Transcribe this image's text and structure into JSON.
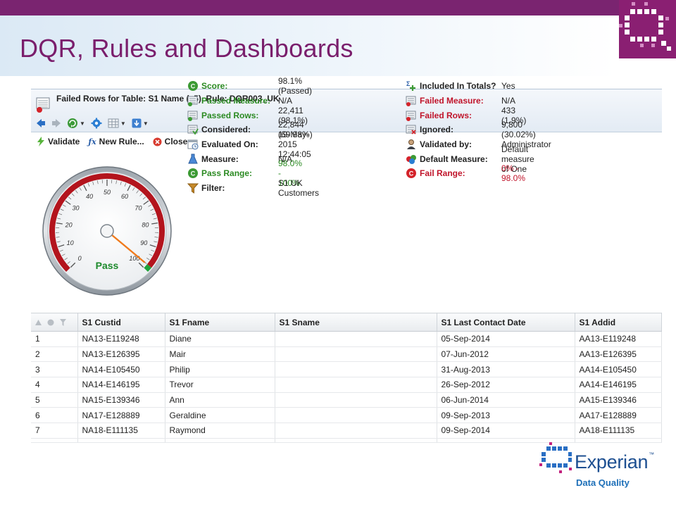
{
  "slide": {
    "title": "DQR, Rules and Dashboards"
  },
  "window": {
    "title": "Failed Rows for Table: S1 Name (v5),  Rule: DQR003_UK"
  },
  "actions": {
    "validate": "Validate",
    "new_rule": "New Rule...",
    "close": "Close"
  },
  "gauge": {
    "status": "Pass",
    "score": 98.1,
    "tick_labels": [
      "0",
      "10",
      "20",
      "30",
      "40",
      "50",
      "60",
      "70",
      "80",
      "90",
      "100"
    ]
  },
  "stats_left": [
    {
      "label": "Score:",
      "value": "98.1%  (Passed)",
      "icon": "score-icon",
      "tone": "green-label"
    },
    {
      "label": "Passed Measure:",
      "value": "N/A",
      "icon": "passed-measure-icon",
      "tone": "green-label"
    },
    {
      "label": "Passed Rows:",
      "value": "22,411 (98.1%)",
      "icon": "passed-rows-icon",
      "tone": "green-label"
    },
    {
      "label": "Considered:",
      "value": "22,844 (69.98%)",
      "icon": "considered-icon",
      "tone": "normal"
    },
    {
      "label": "Evaluated On:",
      "value": "19-May-2015 12:44:05",
      "icon": "calendar-icon",
      "tone": "normal"
    },
    {
      "label": "Measure:",
      "value": "N/A",
      "icon": "flask-icon",
      "tone": "normal"
    },
    {
      "label": "Pass Range:",
      "value": "98.0% - 100%",
      "icon": "pass-range-icon",
      "tone": "green-both"
    },
    {
      "label": "Filter:",
      "value": "S1 UK Customers",
      "icon": "filter-icon",
      "tone": "normal"
    }
  ],
  "stats_right": [
    {
      "label": "Included In Totals?",
      "value": "Yes",
      "icon": "sigma-plus-icon",
      "tone": "normal"
    },
    {
      "label": "Failed Measure:",
      "value": "N/A",
      "icon": "failed-measure-icon",
      "tone": "red-label"
    },
    {
      "label": "Failed Rows:",
      "value": "433 (1.9%)",
      "icon": "failed-rows-icon",
      "tone": "red-label"
    },
    {
      "label": "Ignored:",
      "value": "9,800 (30.02%)",
      "icon": "ignored-icon",
      "tone": "normal"
    },
    {
      "label": "Validated by:",
      "value": "Administrator",
      "icon": "user-icon",
      "tone": "normal"
    },
    {
      "label": "Default Measure:",
      "value": "Default measure of One",
      "icon": "default-measure-icon",
      "tone": "normal"
    },
    {
      "label": "Fail Range:",
      "value": "0% - 98.0%",
      "icon": "fail-range-icon",
      "tone": "red-both"
    }
  ],
  "table": {
    "columns": [
      "S1 Custid",
      "S1 Fname",
      "S1 Sname",
      "S1 Last Contact Date",
      "S1 Addid"
    ],
    "rows": [
      [
        "1",
        "NA13-E119248",
        "Diane",
        "",
        "05-Sep-2014",
        "AA13-E119248"
      ],
      [
        "2",
        "NA13-E126395",
        "Mair",
        "",
        "07-Jun-2012",
        "AA13-E126395"
      ],
      [
        "3",
        "NA14-E105450",
        "Philip",
        "",
        "31-Aug-2013",
        "AA14-E105450"
      ],
      [
        "4",
        "NA14-E146195",
        "Trevor",
        "",
        "26-Sep-2012",
        "AA14-E146195"
      ],
      [
        "5",
        "NA15-E139346",
        "Ann",
        "",
        "06-Jun-2014",
        "AA15-E139346"
      ],
      [
        "6",
        "NA17-E128889",
        "Geraldine",
        "",
        "09-Sep-2013",
        "AA17-E128889"
      ],
      [
        "7",
        "NA18-E111135",
        "Raymond",
        "",
        "09-Sep-2014",
        "AA18-E111135"
      ]
    ]
  },
  "brand": {
    "name": "Experian",
    "tm": "™",
    "sub": "Data Quality",
    "purple": "#7a2470",
    "blue": "#1d4f91"
  }
}
